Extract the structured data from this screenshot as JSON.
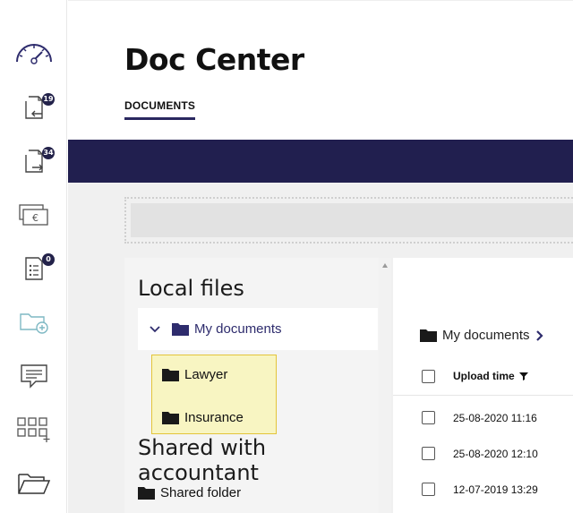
{
  "sidebar": {
    "items": [
      {
        "icon": "speedometer-icon"
      },
      {
        "icon": "incoming-documents-icon",
        "badge": "19"
      },
      {
        "icon": "outgoing-documents-icon",
        "badge": "34"
      },
      {
        "icon": "euro-banknotes-icon"
      },
      {
        "icon": "checklist-document-icon",
        "badge": "0"
      },
      {
        "icon": "add-folder-icon"
      },
      {
        "icon": "message-icon"
      },
      {
        "icon": "add-grid-icon"
      },
      {
        "icon": "open-folder-icon"
      }
    ]
  },
  "header": {
    "title": "Doc Center",
    "tab": "DOCUMENTS"
  },
  "colors": {
    "brand_dark": "#211f4f",
    "selection_fill": "#f8f5c2",
    "selection_border": "#e3c43a",
    "folder_purple": "#2e2c6d",
    "muted_teal": "#7fb9c4"
  },
  "tree": {
    "local_title": "Local files",
    "root_label": "My documents",
    "children": [
      "Lawyer",
      "Insurance"
    ],
    "shared_title": "Shared with accountant",
    "shared_folder": "Shared folder"
  },
  "documents": {
    "breadcrumb": "My documents",
    "column_header": "Upload time",
    "rows": [
      "25-08-2020 11:16",
      "25-08-2020 12:10",
      "12-07-2019 13:29"
    ]
  }
}
